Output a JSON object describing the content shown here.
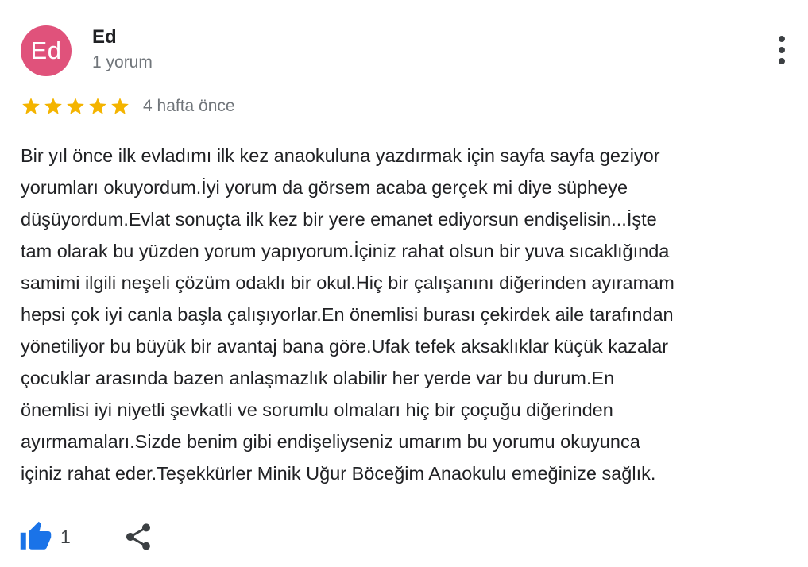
{
  "review": {
    "author": {
      "initials": "Ed",
      "name": "Ed",
      "meta": "1 yorum",
      "avatar_color": "#e0527b"
    },
    "rating": 5,
    "rating_max": 5,
    "date": "4 hafta önce",
    "text": "Bir yıl önce ilk evladımı ilk kez anaokuluna yazdırmak için sayfa sayfa geziyor\nyorumları okuyordum.İyi yorum da görsem acaba gerçek mi diye süpheye\ndüşüyordum.Evlat sonuçta ilk kez bir yere emanet ediyorsun endişelisin...İşte\ntam olarak bu yüzden yorum yapıyorum.İçiniz rahat olsun bir yuva sıcaklığında\nsamimi ilgili neşeli çözüm odaklı bir okul.Hiç bir çalışanını diğerinden ayıramam\nhepsi çok iyi canla başla çalışıyorlar.En önemlisi burası çekirdek aile tarafından\nyönetiliyor bu büyük bir avantaj bana göre.Ufak tefek aksaklıklar küçük kazalar\nçocuklar arasında bazen anlaşmazlık olabilir her yerde var bu durum.En\nönemlisi iyi niyetli şevkatli ve sorumlu olmaları hiç bir çoçuğu diğerinden\nayırmamaları.Sizde benim gibi endişeliyseniz umarım bu yorumu okuyunca\niçiniz rahat eder.Teşekkürler Minik Uğur Böceğim Anaokulu emeğinize sağlık.",
    "likes": "1"
  },
  "icons": {
    "more": "more-vertical-icon",
    "star": "star-icon",
    "like": "thumbs-up-icon",
    "share": "share-icon"
  },
  "colors": {
    "star": "#f4b400",
    "like": "#1a73e8",
    "icon": "#3c4043",
    "secondary_text": "#70757a"
  }
}
